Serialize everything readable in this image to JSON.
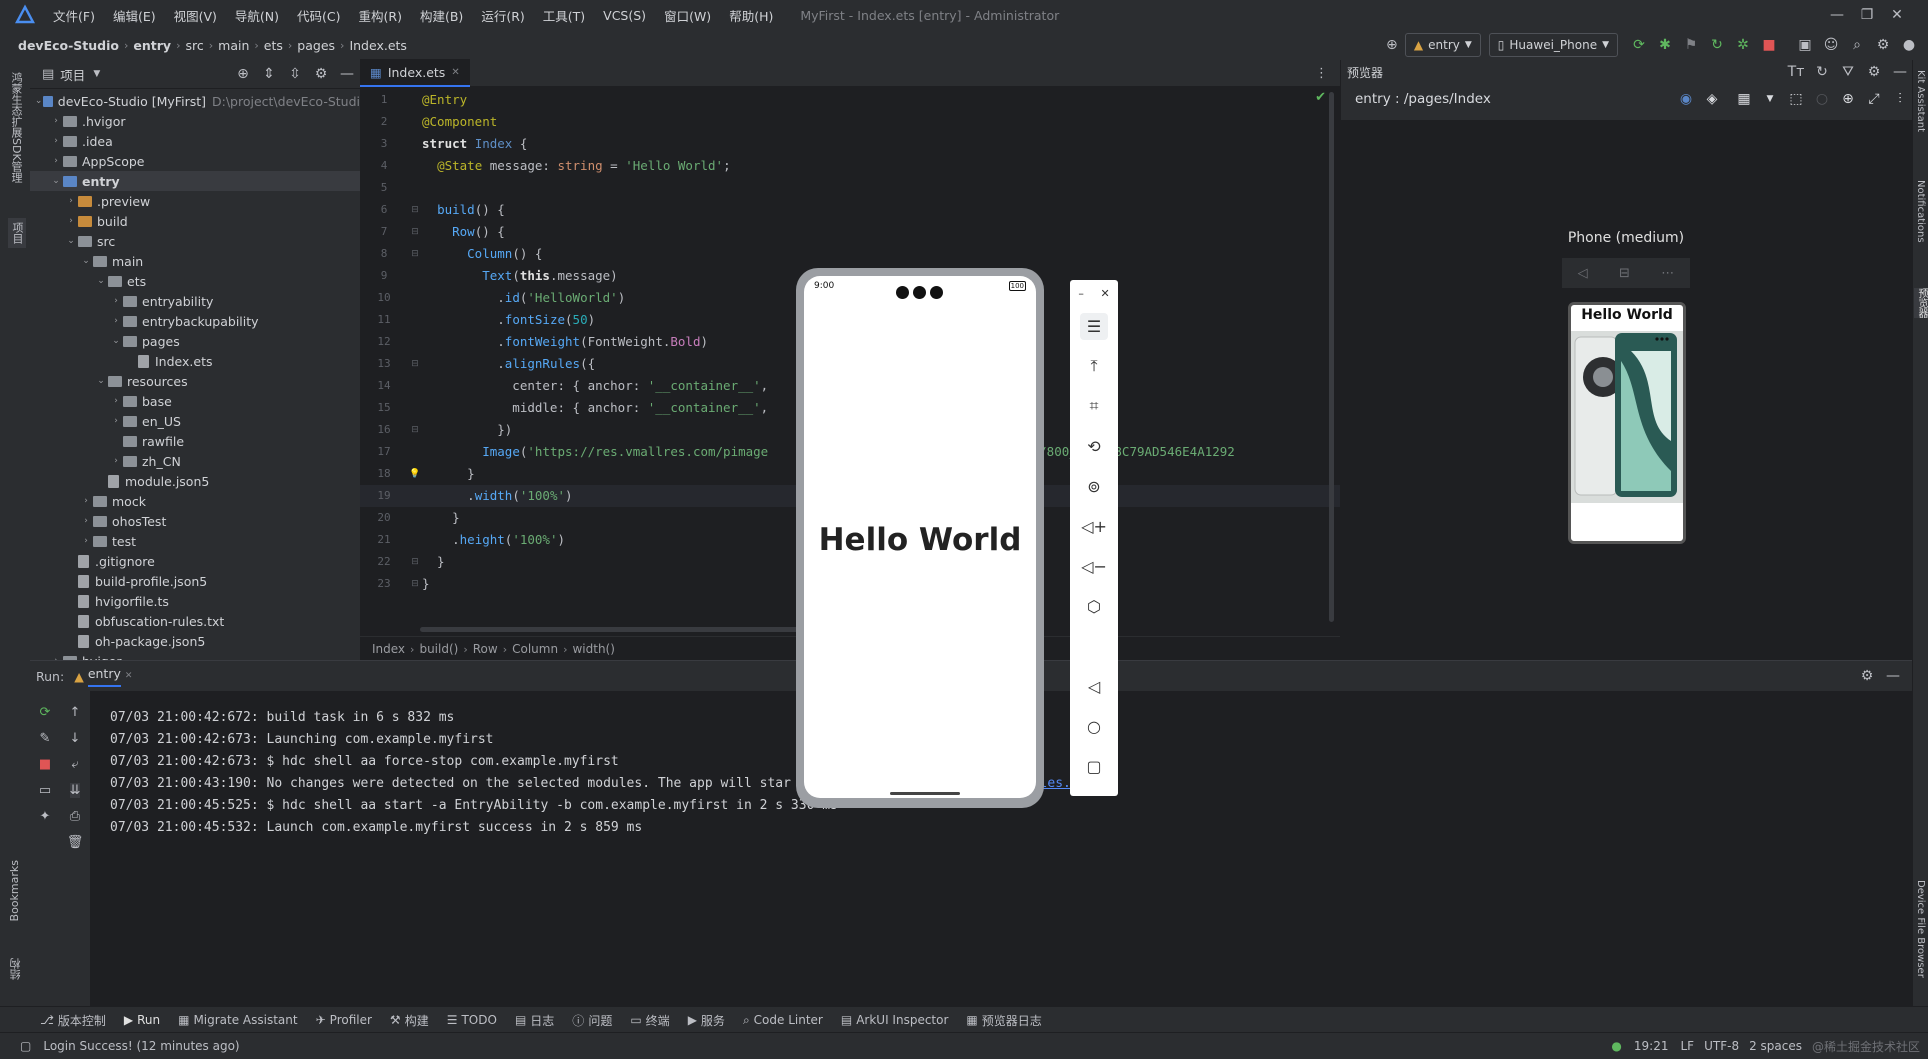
{
  "menubar": {
    "items": [
      "文件(F)",
      "编辑(E)",
      "视图(V)",
      "导航(N)",
      "代码(C)",
      "重构(R)",
      "构建(B)",
      "运行(R)",
      "工具(T)",
      "VCS(S)",
      "窗口(W)",
      "帮助(H)"
    ],
    "window_title": "MyFirst - Index.ets [entry] - Administrator"
  },
  "navbar": {
    "breadcrumbs": [
      "devEco-Studio",
      "entry",
      "src",
      "main",
      "ets",
      "pages",
      "Index.ets"
    ],
    "run_config": "entry",
    "device": "Huawei_Phone"
  },
  "leftstrip": {
    "top_label": "项目",
    "side_label": "鸿蒙生态扩展SDK管理",
    "bookmarks": "Bookmarks",
    "structure": "结构"
  },
  "project": {
    "title": "项目",
    "tree": [
      {
        "label": "devEco-Studio [MyFirst]",
        "extra": "D:\\project\\devEco-Studi",
        "depth": 0,
        "kind": "folder-blue",
        "open": true
      },
      {
        "label": ".hvigor",
        "depth": 1,
        "kind": "folder",
        "open": false
      },
      {
        "label": ".idea",
        "depth": 1,
        "kind": "folder",
        "open": false
      },
      {
        "label": "AppScope",
        "depth": 1,
        "kind": "folder",
        "open": false
      },
      {
        "label": "entry",
        "depth": 1,
        "kind": "folder-blue",
        "open": true,
        "bold": true
      },
      {
        "label": ".preview",
        "depth": 2,
        "kind": "folder-orange",
        "open": false
      },
      {
        "label": "build",
        "depth": 2,
        "kind": "folder-orange",
        "open": false
      },
      {
        "label": "src",
        "depth": 2,
        "kind": "folder",
        "open": true
      },
      {
        "label": "main",
        "depth": 3,
        "kind": "folder",
        "open": true
      },
      {
        "label": "ets",
        "depth": 4,
        "kind": "folder",
        "open": true
      },
      {
        "label": "entryability",
        "depth": 5,
        "kind": "folder",
        "open": false
      },
      {
        "label": "entrybackupability",
        "depth": 5,
        "kind": "folder",
        "open": false
      },
      {
        "label": "pages",
        "depth": 5,
        "kind": "folder",
        "open": true
      },
      {
        "label": "Index.ets",
        "depth": 6,
        "kind": "file"
      },
      {
        "label": "resources",
        "depth": 4,
        "kind": "folder",
        "open": true
      },
      {
        "label": "base",
        "depth": 5,
        "kind": "folder",
        "open": false
      },
      {
        "label": "en_US",
        "depth": 5,
        "kind": "folder",
        "open": false
      },
      {
        "label": "rawfile",
        "depth": 5,
        "kind": "folder",
        "open": null
      },
      {
        "label": "zh_CN",
        "depth": 5,
        "kind": "folder",
        "open": false
      },
      {
        "label": "module.json5",
        "depth": 4,
        "kind": "file"
      },
      {
        "label": "mock",
        "depth": 3,
        "kind": "folder",
        "open": false
      },
      {
        "label": "ohosTest",
        "depth": 3,
        "kind": "folder",
        "open": false
      },
      {
        "label": "test",
        "depth": 3,
        "kind": "folder",
        "open": false
      },
      {
        "label": ".gitignore",
        "depth": 2,
        "kind": "file"
      },
      {
        "label": "build-profile.json5",
        "depth": 2,
        "kind": "file"
      },
      {
        "label": "hvigorfile.ts",
        "depth": 2,
        "kind": "file"
      },
      {
        "label": "obfuscation-rules.txt",
        "depth": 2,
        "kind": "file"
      },
      {
        "label": "oh-package.json5",
        "depth": 2,
        "kind": "file"
      },
      {
        "label": "hvigor",
        "depth": 1,
        "kind": "folder",
        "open": false
      }
    ]
  },
  "editor": {
    "tab": "Index.ets",
    "line_numbers": [
      "1",
      "2",
      "3",
      "4",
      "5",
      "6",
      "7",
      "8",
      "9",
      "10",
      "11",
      "12",
      "13",
      "14",
      "15",
      "16",
      "17",
      "18",
      "19",
      "20",
      "21",
      "22",
      "23"
    ],
    "lines": [
      [
        [
          "an",
          "@Entry"
        ]
      ],
      [
        [
          "an",
          "@Component"
        ]
      ],
      [
        [
          "bold",
          "struct "
        ],
        [
          "cls",
          "Index"
        ],
        [
          "plain",
          " {"
        ]
      ],
      [
        [
          "plain",
          "  "
        ],
        [
          "an",
          "@State"
        ],
        [
          "plain",
          " message: "
        ],
        [
          "kw",
          "string"
        ],
        [
          "plain",
          " = "
        ],
        [
          "st",
          "'Hello World'"
        ],
        [
          "plain",
          ";"
        ]
      ],
      [],
      [
        [
          "plain",
          "  "
        ],
        [
          "fn",
          "build"
        ],
        [
          "plain",
          "() {"
        ]
      ],
      [
        [
          "plain",
          "    "
        ],
        [
          "fn",
          "Row"
        ],
        [
          "plain",
          "() {"
        ]
      ],
      [
        [
          "plain",
          "      "
        ],
        [
          "fn",
          "Column"
        ],
        [
          "plain",
          "() {"
        ]
      ],
      [
        [
          "plain",
          "        "
        ],
        [
          "fn",
          "Text"
        ],
        [
          "plain",
          "("
        ],
        [
          "bold",
          "this"
        ],
        [
          "plain",
          ".message)"
        ]
      ],
      [
        [
          "plain",
          "          ."
        ],
        [
          "fn",
          "id"
        ],
        [
          "plain",
          "("
        ],
        [
          "st",
          "'HelloWorld'"
        ],
        [
          "plain",
          ")"
        ]
      ],
      [
        [
          "plain",
          "          ."
        ],
        [
          "fn",
          "fontSize"
        ],
        [
          "plain",
          "("
        ],
        [
          "num",
          "50"
        ],
        [
          "plain",
          ")"
        ]
      ],
      [
        [
          "plain",
          "          ."
        ],
        [
          "fn",
          "fontWeight"
        ],
        [
          "plain",
          "(FontWeight."
        ],
        [
          "prop",
          "Bold"
        ],
        [
          "plain",
          ")"
        ]
      ],
      [
        [
          "plain",
          "          ."
        ],
        [
          "fn",
          "alignRules"
        ],
        [
          "plain",
          "({"
        ]
      ],
      [
        [
          "plain",
          "            center: { anchor: "
        ],
        [
          "st",
          "'__container__'"
        ],
        [
          "plain",
          ","
        ]
      ],
      [
        [
          "plain",
          "            middle: { anchor: "
        ],
        [
          "st",
          "'__container__'"
        ],
        [
          "plain",
          ","
        ]
      ],
      [
        [
          "plain",
          "          })"
        ]
      ],
      [
        [
          "plain",
          "        "
        ],
        [
          "fn",
          "Image"
        ],
        [
          "plain",
          "("
        ],
        [
          "st",
          "'https://res.vmallres.com/pimage"
        ],
        [
          "plain",
          "                          "
        ],
        [
          "st",
          "421"
        ],
        [
          "plain",
          "      "
        ],
        [
          "st",
          "6/800_800_D8C79AD546E4A1292"
        ]
      ],
      [
        [
          "plain",
          "      }"
        ]
      ],
      [
        [
          "plain",
          "      ."
        ],
        [
          "fn",
          "width"
        ],
        [
          "plain",
          "("
        ],
        [
          "st",
          "'100%'"
        ],
        [
          "plain",
          ")"
        ]
      ],
      [
        [
          "plain",
          "    }"
        ]
      ],
      [
        [
          "plain",
          "    ."
        ],
        [
          "fn",
          "height"
        ],
        [
          "plain",
          "("
        ],
        [
          "st",
          "'100%'"
        ],
        [
          "plain",
          ")"
        ]
      ],
      [
        [
          "plain",
          "  }"
        ]
      ],
      [
        [
          "plain",
          "}"
        ]
      ]
    ],
    "breadcrumb": [
      "Index",
      "build()",
      "Row",
      "Column",
      "width()"
    ]
  },
  "preview": {
    "title": "预览器",
    "path": "entry : /pages/Index",
    "device_label": "Phone (medium)",
    "mini_text": "Hello World"
  },
  "rightstrip": [
    "Kit Assistant",
    "Notifications",
    "预览器",
    "Device File Browser"
  ],
  "run": {
    "label": "Run:",
    "tab": "entry",
    "logs": [
      "07/03 21:00:42:672: build task in 6 s 832 ms",
      "07/03 21:00:42:673: Launching com.example.myfirst",
      "07/03 21:00:42:673: $ hdc shell aa force-stop com.example.myfirst",
      "07/03 21:00:43:190: No changes were detected on the selected modules. The app will star",
      "07/03 21:00:45:525: $ hdc shell aa start -a EntryAbility -b com.example.myfirst in 2 s 330 ms",
      "07/03 21:00:45:532: Launch com.example.myfirst success in 2 s 859 ms"
    ],
    "log_link": "all modules."
  },
  "phone": {
    "time": "9:00",
    "battery": "100",
    "text": "Hello World"
  },
  "bottombar": {
    "items": [
      "版本控制",
      "Run",
      "Migrate Assistant",
      "Profiler",
      "构建",
      "TODO",
      "日志",
      "问题",
      "终端",
      "服务",
      "Code Linter",
      "ArkUI Inspector",
      "预览器日志"
    ]
  },
  "status": {
    "message": "Login Success! (12 minutes ago)",
    "time": "19:21",
    "lf": "LF",
    "enc": "UTF-8",
    "indent": "2 spaces",
    "watermark": "@稀土掘金技术社区"
  }
}
